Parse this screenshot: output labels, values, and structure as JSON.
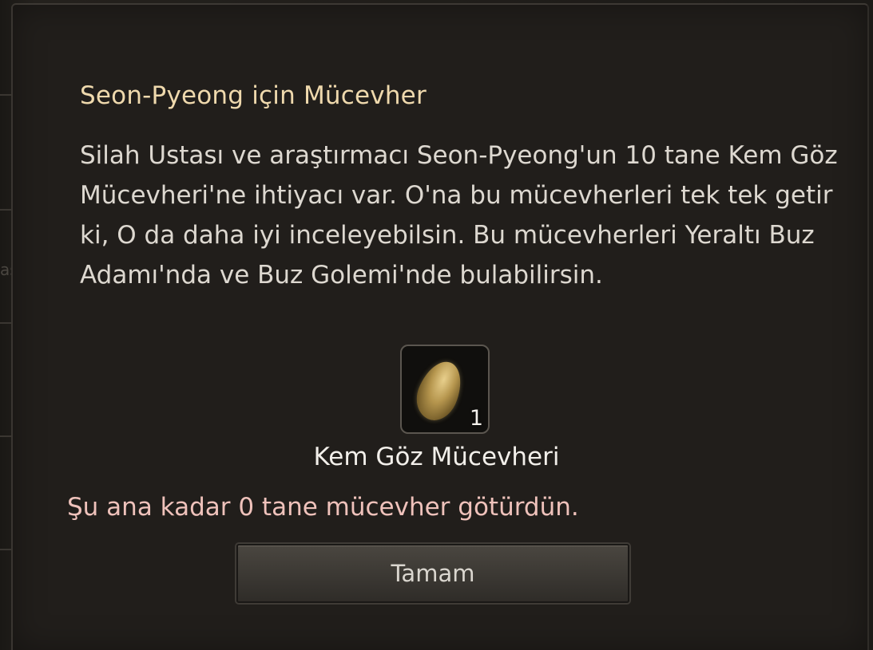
{
  "dialog": {
    "title": "Seon-Pyeong için Mücevher",
    "description": "Silah Ustası ve araştırmacı Seon-Pyeong'un 10 tane Kem Göz Mücevheri'ne ihtiyacı var. O'na bu mücevherleri tek tek getir ki, O da daha iyi inceleyebilsin. Bu mücevherleri Yeraltı Buz Adamı'nda ve Buz Golemi'nde bulabilirsin.",
    "item": {
      "icon": "gem-icon",
      "quantity": "1",
      "name": "Kem Göz Mücevheri"
    },
    "progress_text": "Şu ana kadar 0 tane mücevher götürdün.",
    "ok_label": "Tamam"
  },
  "background": {
    "side_text": "ası"
  },
  "colors": {
    "title": "#efd9ad",
    "body_text": "#ddd8d0",
    "progress_text": "#efc2bb",
    "panel": "#211e1b"
  }
}
